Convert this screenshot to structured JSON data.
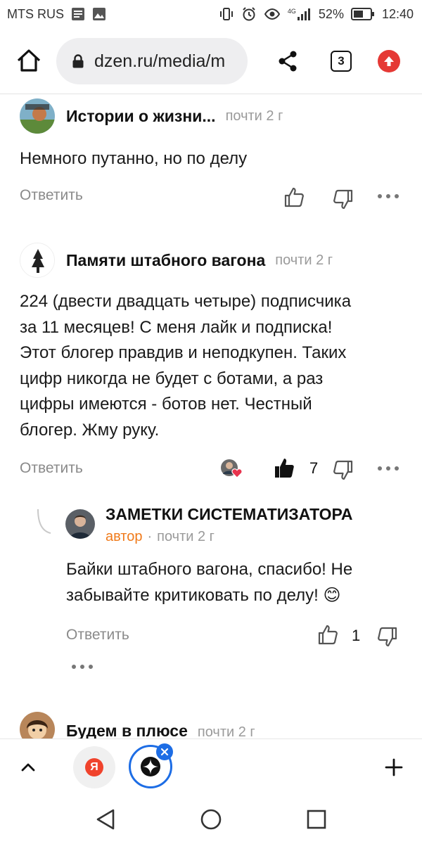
{
  "status_bar": {
    "carrier": "MTS RUS",
    "network": "4G",
    "battery": "52%",
    "time": "12:40"
  },
  "browser": {
    "url": "dzen.ru/media/m",
    "tabs_count": "3",
    "accent_color": "#1d6de5",
    "update_color": "#e53935"
  },
  "comments": [
    {
      "author": "Истории о жизни...",
      "time": "почти 2 г",
      "text": "Немного путанно, но по делу",
      "reply_label": "Ответить"
    },
    {
      "author": "Памяти штабного вагона",
      "time": "почти 2 г",
      "text_lines": [
        "224 (двести двадцать четыре) подписчика",
        "за 11 месяцев! С меня лайк и подписка!",
        "Этот блогер правдив и неподкупен. Таких",
        "цифр никогда не будет с ботами, а раз",
        "цифры имеются - ботов нет. Честный",
        "блогер. Жму руку."
      ],
      "reply_label": "Ответить",
      "likes": "7"
    }
  ],
  "reply": {
    "author": "ЗАМЕТКИ СИСТЕМАТИЗАТОРА",
    "badge": "автор",
    "separator": "·",
    "time": "почти 2 г",
    "text_lines": [
      "Байки штабного вагона, спасибо! Не",
      "забывайте критиковать по делу! 😊"
    ],
    "reply_label": "Ответить",
    "likes": "1"
  },
  "next_comment": {
    "author": "Будем в плюсе",
    "time": "почти 2 г"
  },
  "bottom_bar": {
    "yandex_letter": "Я"
  }
}
